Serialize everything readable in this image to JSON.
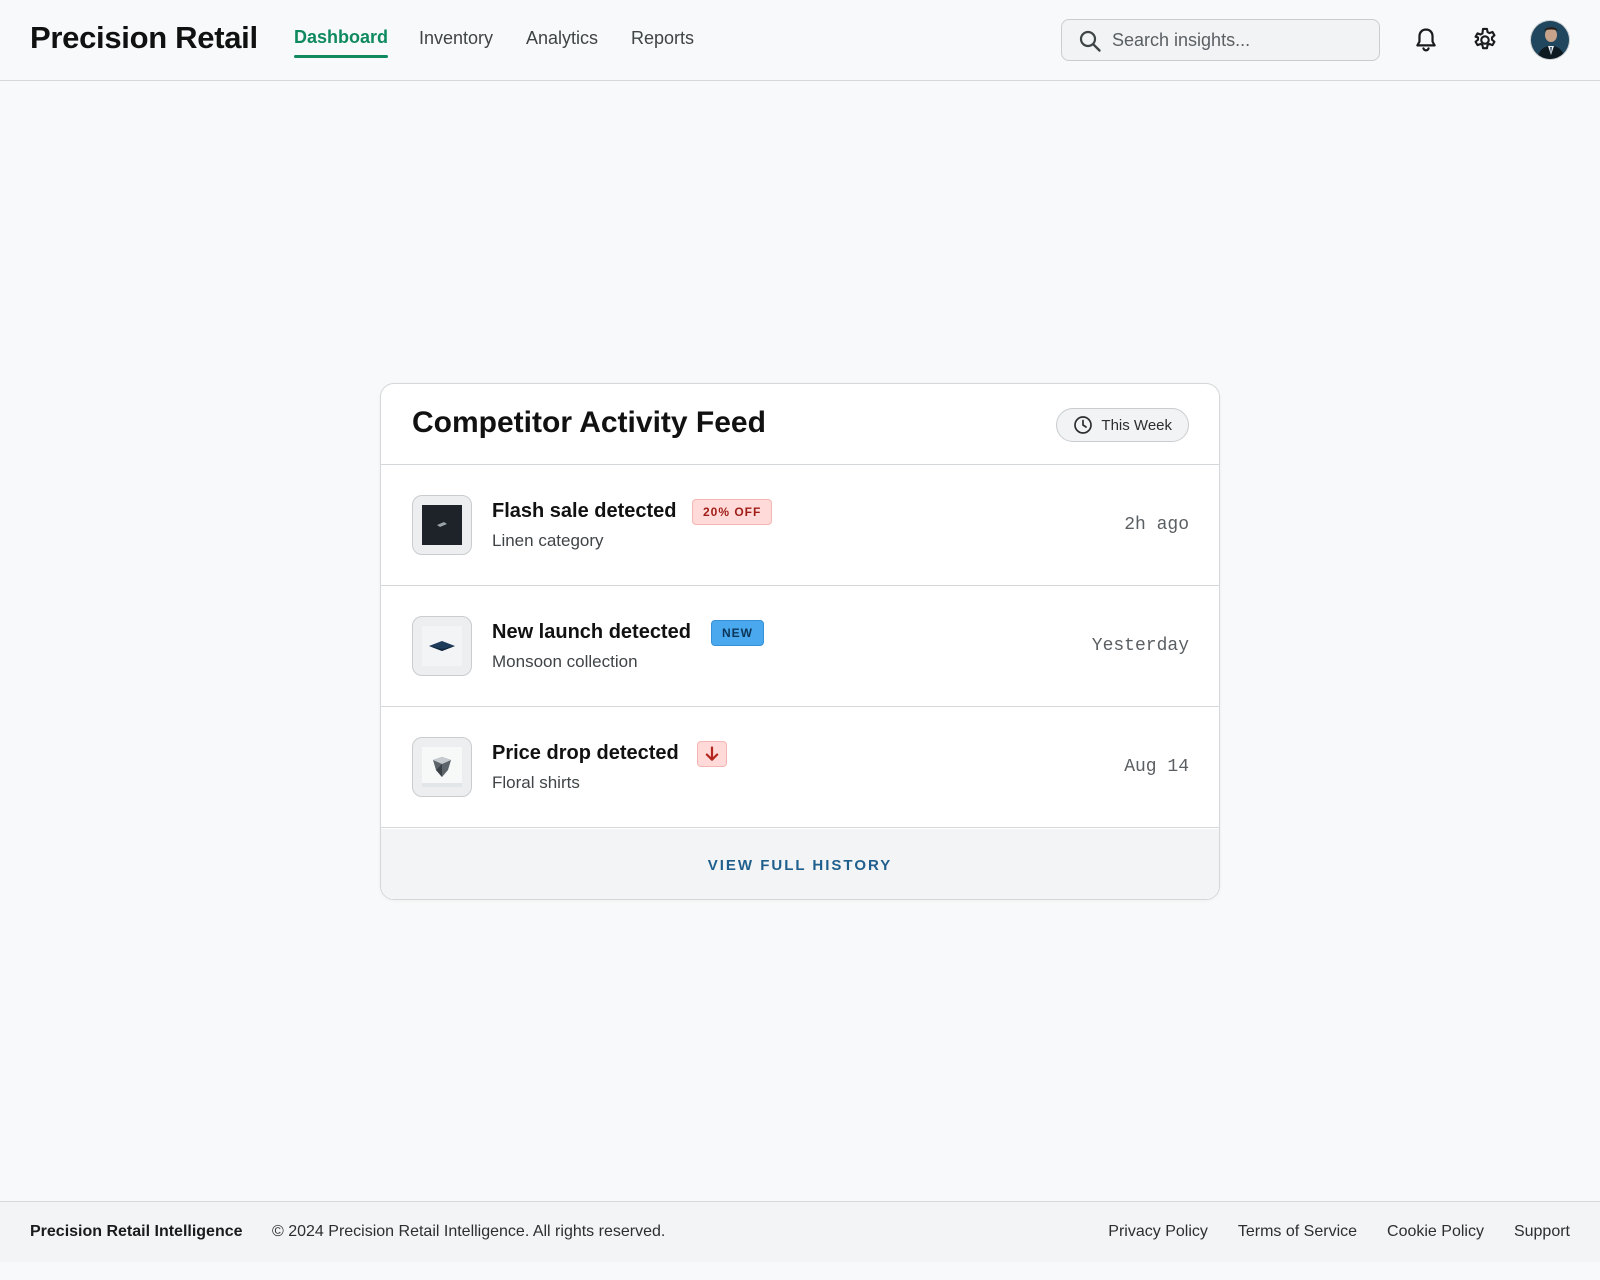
{
  "header": {
    "brand": "Precision Retail",
    "nav": [
      {
        "label": "Dashboard",
        "active": true
      },
      {
        "label": "Inventory",
        "active": false
      },
      {
        "label": "Analytics",
        "active": false
      },
      {
        "label": "Reports",
        "active": false
      }
    ],
    "search": {
      "placeholder": "Search insights...",
      "value": "",
      "icon": "search-icon"
    },
    "icons": [
      "bell-icon",
      "gear-icon"
    ],
    "avatar": "user-avatar"
  },
  "feed": {
    "title": "Competitor Activity Feed",
    "period": {
      "label": "This Week",
      "icon": "clock-icon"
    },
    "items": [
      {
        "title": "Flash sale detected",
        "badge": "20% OFF",
        "badge_type": "sale",
        "subtitle": "Linen category",
        "time": "2h ago"
      },
      {
        "title": "New launch detected",
        "badge": "NEW",
        "badge_type": "new",
        "subtitle": "Monsoon collection",
        "time": "Yesterday"
      },
      {
        "title": "Price drop detected",
        "badge_icon": "arrow-down-icon",
        "badge_type": "drop",
        "subtitle": "Floral shirts",
        "time": "Aug 14"
      }
    ],
    "footer_link": "VIEW FULL HISTORY"
  },
  "footer": {
    "brand": "Precision Retail Intelligence",
    "copyright": "© 2024 Precision Retail Intelligence. All rights reserved.",
    "links": [
      "Privacy Policy",
      "Terms of Service",
      "Cookie Policy",
      "Support"
    ]
  },
  "colors": {
    "accent_green": "#0f8a5f",
    "link_blue": "#1f5f8e",
    "sale_badge": "#ffdad8",
    "new_badge": "#4aa8ee",
    "background": "#f8f9fa"
  }
}
